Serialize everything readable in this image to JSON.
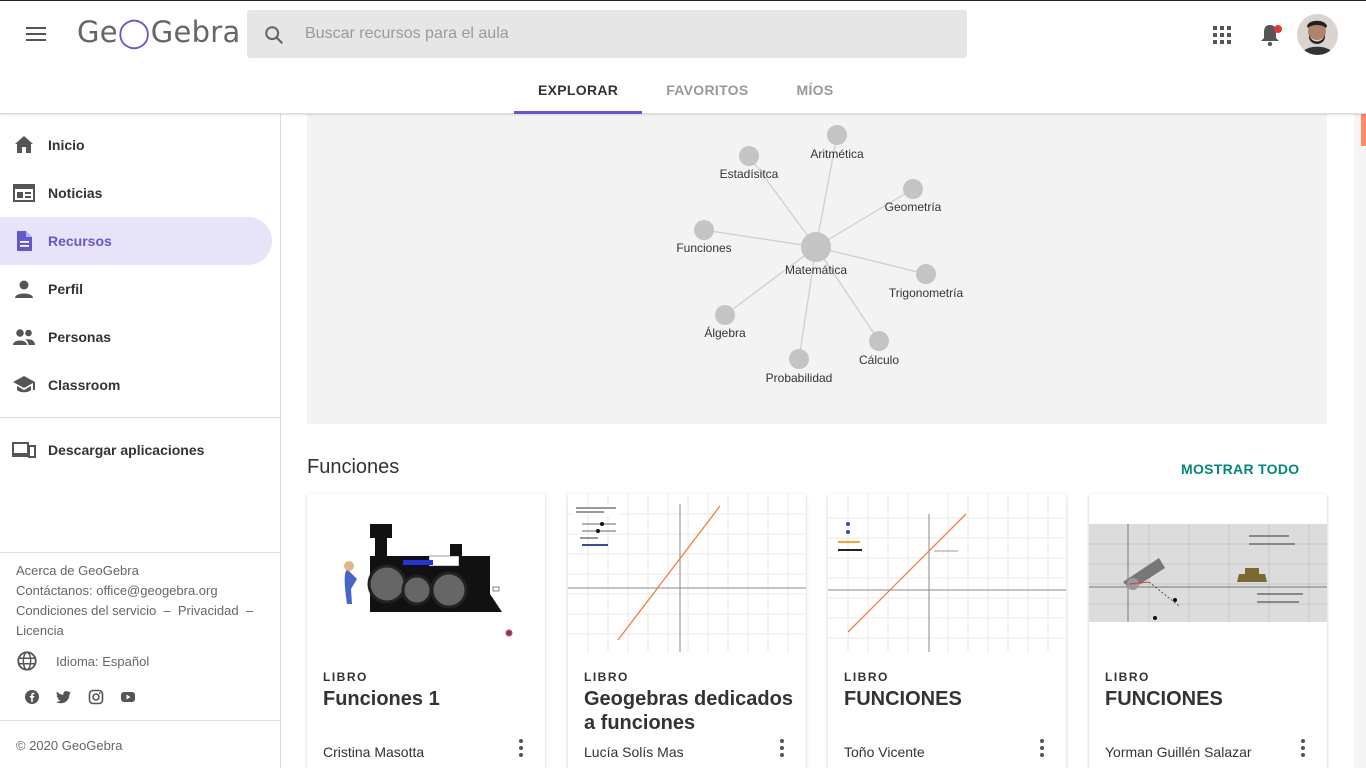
{
  "header": {
    "logo": "GeoGebra",
    "search_placeholder": "Buscar recursos para el aula",
    "tabs": [
      {
        "label": "EXPLORAR",
        "active": true
      },
      {
        "label": "FAVORITOS",
        "active": false
      },
      {
        "label": "MÍOS",
        "active": false
      }
    ],
    "icons": [
      "menu-icon",
      "search-icon",
      "apps-grid-icon",
      "notifications-icon",
      "user-avatar"
    ]
  },
  "sidebar": {
    "items": [
      {
        "label": "Inicio",
        "icon": "home-icon"
      },
      {
        "label": "Noticias",
        "icon": "news-icon"
      },
      {
        "label": "Recursos",
        "icon": "document-icon",
        "active": true
      },
      {
        "label": "Perfil",
        "icon": "person-icon"
      },
      {
        "label": "Personas",
        "icon": "people-icon"
      },
      {
        "label": "Classroom",
        "icon": "school-icon"
      }
    ],
    "download": {
      "label": "Descargar aplicaciones",
      "icon": "devices-icon"
    },
    "footer": {
      "about": "Acerca de GeoGebra",
      "contact": "Contáctanos: office@geogebra.org",
      "terms": "Condiciones del servicio",
      "sep1": "–",
      "privacy": "Privacidad",
      "sep2": "–",
      "license": "Licencia",
      "language": "Idioma: Español",
      "social": [
        "facebook-icon",
        "twitter-icon",
        "instagram-icon",
        "youtube-icon"
      ],
      "copyright": "© 2020 GeoGebra"
    }
  },
  "topic_graph": {
    "center": "Matemática",
    "nodes": [
      "Aritmética",
      "Estadísitca",
      "Geometría",
      "Funciones",
      "Trigonometría",
      "Álgebra",
      "Cálculo",
      "Probabilidad"
    ]
  },
  "section": {
    "title": "Funciones",
    "show_all": "MOSTRAR TODO",
    "cards": [
      {
        "type": "LIBRO",
        "title": "Funciones 1",
        "author": "Cristina Masotta"
      },
      {
        "type": "LIBRO",
        "title": "Geogebras dedicados a funciones",
        "author": "Lucía Solís Mas"
      },
      {
        "type": "LIBRO",
        "title": "FUNCIONES",
        "author": "Toño Vicente"
      },
      {
        "type": "LIBRO",
        "title": "FUNCIONES",
        "author": "Yorman Guillén Salazar"
      }
    ]
  },
  "colors": {
    "accent": "#6557d2",
    "active_bg": "#e8e4f8",
    "teal": "#00897b",
    "node": "#c4c4c4"
  }
}
